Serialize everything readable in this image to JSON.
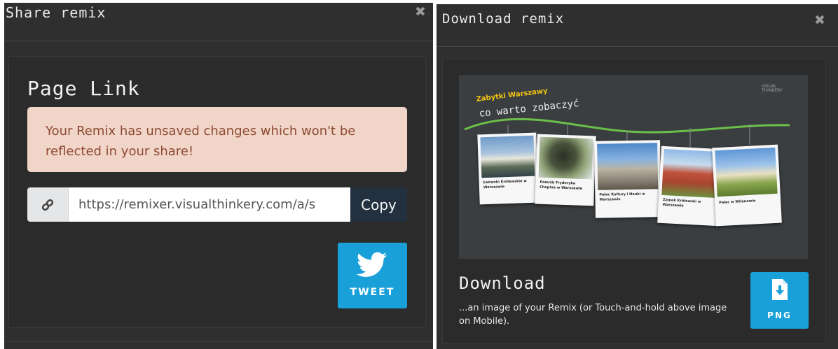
{
  "share_modal": {
    "title": "Share remix",
    "close_glyph": "✖",
    "heading": "Page Link",
    "alert_text": "Your Remix has unsaved changes which won't be reflected in your share!",
    "url_value": "https://remixer.visualthinkery.com/a/s",
    "copy_label": "Copy",
    "tweet_label": "TWEET",
    "link_icon": "link-icon",
    "tweet_icon": "twitter-bird-icon"
  },
  "download_modal": {
    "title": "Download remix",
    "close_glyph": "✖",
    "preview": {
      "title_line1": "Zabytki Warszawy",
      "title_line2": "co warto zobaczyć",
      "logo_text_1": "VISUAL",
      "logo_text_2": "THINKERY",
      "cards": [
        {
          "caption": "Łazienki Królewskie w Warszawie"
        },
        {
          "caption": "Pomnik Fryderyka Chopina w Warszawie"
        },
        {
          "caption": "Pałac Kultury i Nauki w Warszawie"
        },
        {
          "caption": "Zamek Królewski w Warszawie"
        },
        {
          "caption": "Pałac w Wilanowie"
        }
      ]
    },
    "heading": "Download",
    "description": "...an image of your Remix (or Touch-and-hold above image on Mobile).",
    "png_label": "PNG",
    "png_icon": "file-download-icon"
  },
  "colors": {
    "modal_bg": "#2f2f2f",
    "accent_blue": "#1aa0d8",
    "alert_bg": "#f1d5c9",
    "alert_text": "#8e4a32",
    "copy_bg": "#22303f"
  }
}
